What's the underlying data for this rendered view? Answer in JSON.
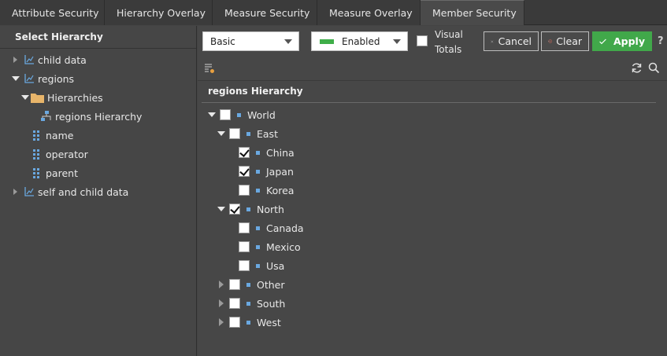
{
  "tabs": [
    {
      "label": "Attribute Security",
      "icon": "attribute-security-icon",
      "active": false
    },
    {
      "label": "Hierarchy Overlay",
      "icon": "hierarchy-overlay-icon",
      "active": false
    },
    {
      "label": "Measure Security",
      "icon": "measure-security-icon",
      "active": false
    },
    {
      "label": "Measure Overlay",
      "icon": "measure-overlay-icon",
      "active": false
    },
    {
      "label": "Member Security",
      "icon": "member-security-icon",
      "active": true
    }
  ],
  "left_panel": {
    "header": "Select Hierarchy",
    "tree": [
      {
        "label": "child data",
        "caret": "right",
        "icon": "dimension-icon"
      },
      {
        "label": "regions",
        "caret": "down",
        "icon": "dimension-icon"
      },
      {
        "label": "Hierarchies",
        "caret": "down",
        "icon": "folder-icon"
      },
      {
        "label": "regions Hierarchy",
        "caret": "",
        "icon": "hierarchy-icon"
      },
      {
        "label": "name",
        "caret": "",
        "icon": "level-icon"
      },
      {
        "label": "operator",
        "caret": "",
        "icon": "level-icon"
      },
      {
        "label": "parent",
        "caret": "",
        "icon": "level-icon"
      },
      {
        "label": "self and child data",
        "caret": "right",
        "icon": "dimension-icon"
      }
    ]
  },
  "toolbar": {
    "mode_select": "Basic",
    "state_select": "Enabled",
    "visual_totals_line1": "Visual",
    "visual_totals_line2": "Totals",
    "visual_totals_checked": false,
    "cancel_label": "Cancel",
    "clear_label": "Clear",
    "apply_label": "Apply",
    "help_label": "?"
  },
  "members": {
    "title": "regions Hierarchy",
    "rows": [
      {
        "label": "World",
        "caret": "down",
        "checked": false
      },
      {
        "label": "East",
        "caret": "down",
        "checked": false
      },
      {
        "label": "China",
        "caret": "",
        "checked": true
      },
      {
        "label": "Japan",
        "caret": "",
        "checked": true
      },
      {
        "label": "Korea",
        "caret": "",
        "checked": false
      },
      {
        "label": "North",
        "caret": "down",
        "checked": true
      },
      {
        "label": "Canada",
        "caret": "",
        "checked": false
      },
      {
        "label": "Mexico",
        "caret": "",
        "checked": false
      },
      {
        "label": "Usa",
        "caret": "",
        "checked": false
      },
      {
        "label": "Other",
        "caret": "right",
        "checked": false
      },
      {
        "label": "South",
        "caret": "right",
        "checked": false
      },
      {
        "label": "West",
        "caret": "right",
        "checked": false
      }
    ]
  },
  "colors": {
    "accent_green": "#41a84a",
    "bullet_blue": "#6aa8e0",
    "folder": "#e8b56a"
  }
}
